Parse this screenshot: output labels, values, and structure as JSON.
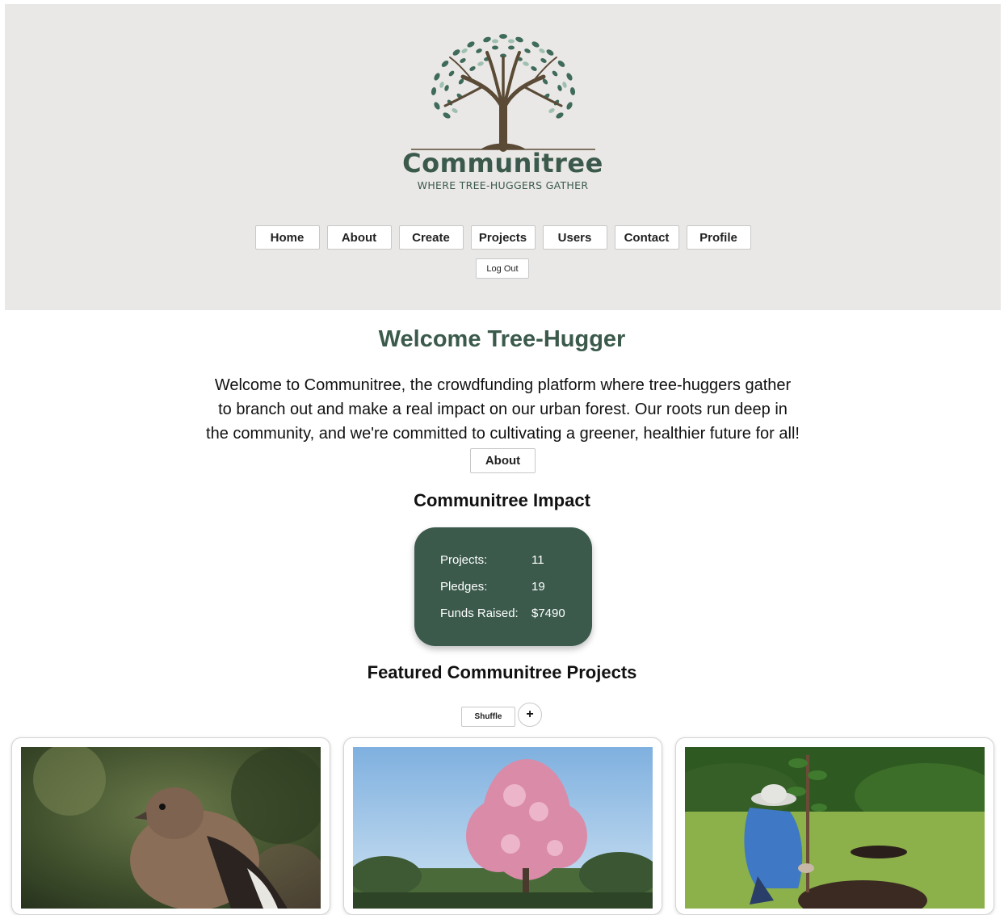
{
  "header": {
    "brand": "Communitree",
    "tagline": "WHERE TREE-HUGGERS GATHER",
    "nav": [
      "Home",
      "About",
      "Create",
      "Projects",
      "Users",
      "Contact",
      "Profile"
    ],
    "logout": "Log Out",
    "colors": {
      "background": "#eae8e6",
      "brand": "#3b5a4c",
      "trunk": "#5a4a36"
    }
  },
  "main": {
    "welcome": "Welcome Tree-Hugger",
    "intro": "Welcome to Communitree, the crowdfunding platform where tree-huggers gather to branch out and make a real impact on our urban forest. Our roots run deep in the community, and we're committed to cultivating a greener, healthier future for all!",
    "about_button": "About",
    "impact": {
      "title": "Communitree Impact",
      "rows": [
        {
          "label": "Projects:",
          "value": "11"
        },
        {
          "label": "Pledges:",
          "value": "19"
        },
        {
          "label": "Funds Raised:",
          "value": "$7490"
        }
      ]
    },
    "featured": {
      "title": "Featured Communitree Projects",
      "shuffle": "Shuffle",
      "add": "+",
      "projects": [
        {
          "image": "bird-photo"
        },
        {
          "image": "blossom-tree-photo"
        },
        {
          "image": "gardener-planting-tree-photo"
        }
      ]
    }
  }
}
